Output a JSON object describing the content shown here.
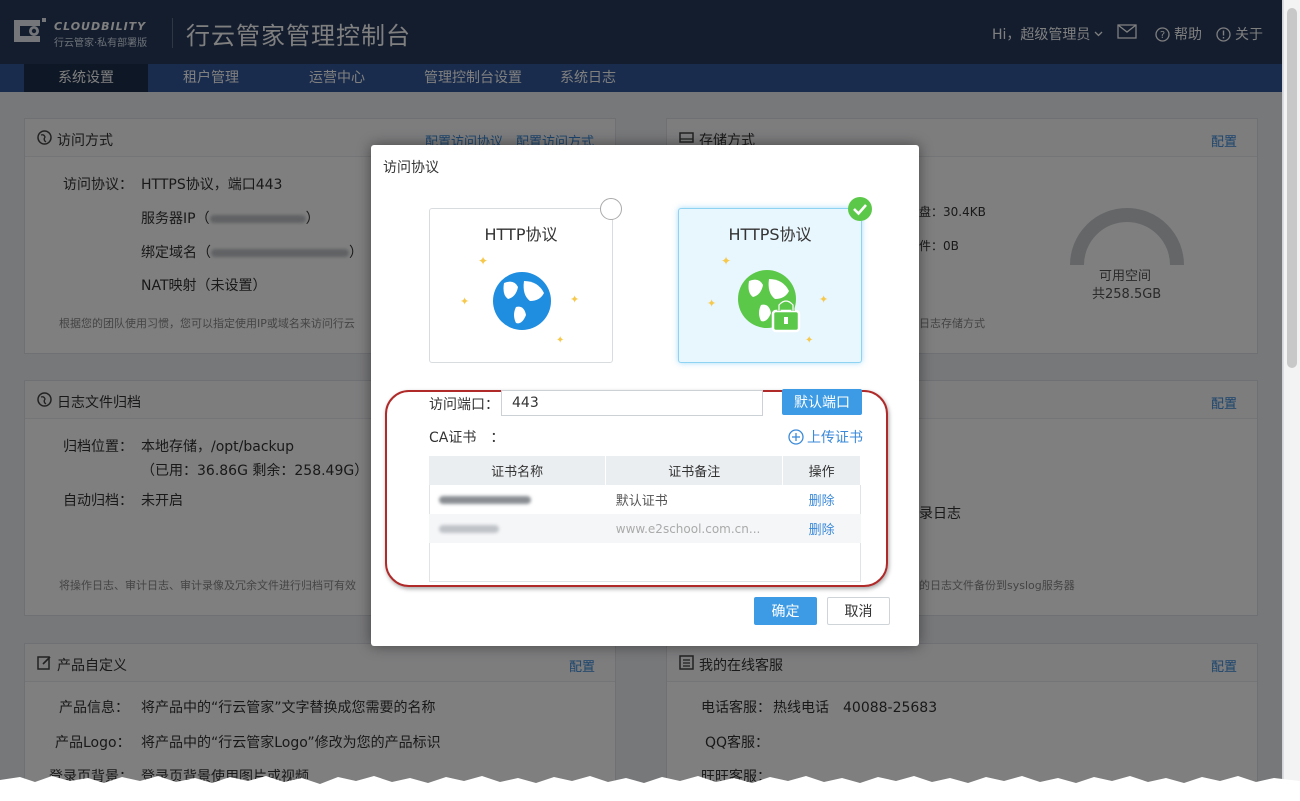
{
  "header": {
    "brand": "CLOUDBILITY",
    "brand_sub": "行云管家·私有部署版",
    "title": "行云管家管理控制台",
    "user": "Hi，超级管理员",
    "help": "帮助",
    "about": "关于"
  },
  "nav": {
    "tabs": [
      "系统设置",
      "租户管理",
      "运营中心",
      "管理控制台设置",
      "系统日志"
    ],
    "active": 0
  },
  "access": {
    "title": "访问方式",
    "link1": "配置访问协议",
    "link2": "配置访问方式",
    "protocol_label": "访问协议：",
    "protocol_value": "HTTPS协议，端口443",
    "server_ip": "服务器IP（",
    "server_ip_end": "）",
    "domain": "绑定域名（",
    "domain_end": "）",
    "nat": "NAT映射（未设置）",
    "note": "根据您的团队使用习惯，您可以指定使用IP或域名来访问行云"
  },
  "storage": {
    "title": "存储方式",
    "link": "配置",
    "line1": "盘：30.4KB",
    "line2": "件：0B",
    "gauge_label": "可用空间",
    "gauge_total": "共258.5GB",
    "used_fraction": 0.0,
    "note": "日志存储方式"
  },
  "log": {
    "title": "日志文件归档",
    "location_label": "归档位置：",
    "location_value": "本地存储，/opt/backup",
    "usage": "（已用：36.86G 剩余：258.49G）",
    "auto_label": "自动归档：",
    "auto_value": "未开启",
    "note": "将操作日志、审计日志、审计录像及冗余文件进行归档可有效"
  },
  "syslog": {
    "link": "配置",
    "line": "录日志",
    "note": "的日志文件备份到syslog服务器"
  },
  "product": {
    "title": "产品自定义",
    "link": "配置",
    "info_label": "产品信息：",
    "info_value": "将产品中的“行云管家”文字替换成您需要的名称",
    "logo_label": "产品Logo：",
    "logo_value": "将产品中的“行云管家Logo”修改为您的产品标识",
    "bg_label": "登录页背景：",
    "bg_value": "登录页背景使用图片或视频"
  },
  "service": {
    "title": "我的在线客服",
    "link": "配置",
    "phone_label": "电话客服：",
    "phone_value": "热线电话　40088-25683",
    "qq_label": "QQ客服：",
    "ww_label": "旺旺客服："
  },
  "modal": {
    "title": "访问协议",
    "http": "HTTP协议",
    "https": "HTTPS协议",
    "selected": "https",
    "port_label": "访问端口：",
    "port_value": "443",
    "default_port": "默认端口",
    "ca_label": "CA证书　：",
    "upload": "上传证书",
    "columns": [
      "证书名称",
      "证书备注",
      "操作"
    ],
    "rows": [
      {
        "remark": "默认证书",
        "action": "删除"
      },
      {
        "remark": "www.e2school.com.cn...",
        "action": "删除"
      }
    ],
    "ok": "确定",
    "cancel": "取消"
  }
}
